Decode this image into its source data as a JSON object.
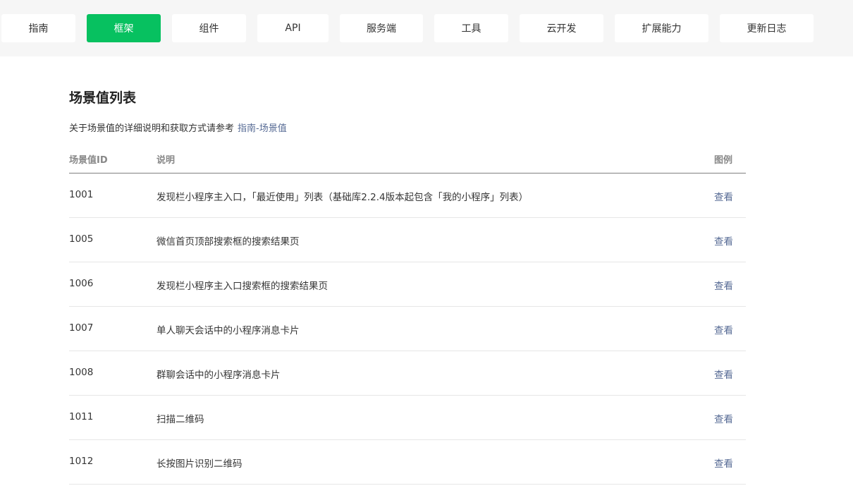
{
  "nav": {
    "tabs": [
      {
        "label": "指南",
        "active": false
      },
      {
        "label": "框架",
        "active": true
      },
      {
        "label": "组件",
        "active": false
      },
      {
        "label": "API",
        "active": false
      },
      {
        "label": "服务端",
        "active": false
      },
      {
        "label": "工具",
        "active": false
      },
      {
        "label": "云开发",
        "active": false
      },
      {
        "label": "扩展能力",
        "active": false
      },
      {
        "label": "更新日志",
        "active": false
      }
    ]
  },
  "page": {
    "title": "场景值列表",
    "intro_text": "关于场景值的详细说明和获取方式请参考",
    "intro_link": "指南-场景值"
  },
  "table": {
    "headers": {
      "id": "场景值ID",
      "desc": "说明",
      "example": "图例"
    },
    "rows": [
      {
        "id": "1001",
        "desc": "发现栏小程序主入口，「最近使用」列表（基础库2.2.4版本起包含「我的小程序」列表）",
        "example": "查看"
      },
      {
        "id": "1005",
        "desc": "微信首页顶部搜索框的搜索结果页",
        "example": "查看"
      },
      {
        "id": "1006",
        "desc": "发现栏小程序主入口搜索框的搜索结果页",
        "example": "查看"
      },
      {
        "id": "1007",
        "desc": "单人聊天会话中的小程序消息卡片",
        "example": "查看"
      },
      {
        "id": "1008",
        "desc": "群聊会话中的小程序消息卡片",
        "example": "查看"
      },
      {
        "id": "1011",
        "desc": "扫描二维码",
        "example": "查看"
      },
      {
        "id": "1012",
        "desc": "长按图片识别二维码",
        "example": "查看"
      }
    ]
  },
  "colors": {
    "accent": "#07c160",
    "link": "#576b95",
    "nav_background": "#f6f6f6"
  }
}
